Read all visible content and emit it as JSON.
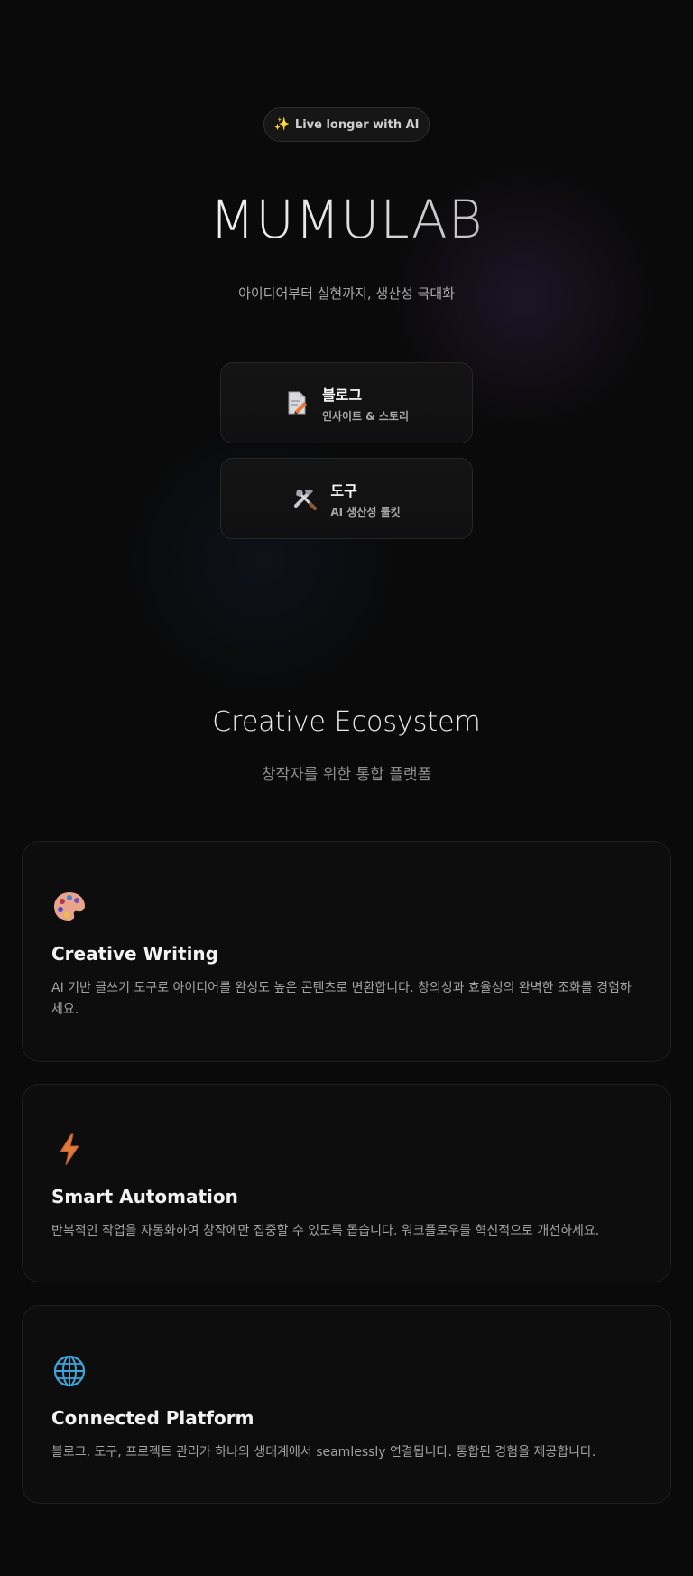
{
  "hero": {
    "pill_text": "Live longer with AI",
    "brand": "MUMULAB",
    "tagline": "아이디어부터 실현까지, 생산성 극대화"
  },
  "nav_cards": [
    {
      "title": "블로그",
      "subtitle": "인사이트 & 스토리",
      "icon": "memo-icon"
    },
    {
      "title": "도구",
      "subtitle": "AI 생산성 툴킷",
      "icon": "tools-icon"
    }
  ],
  "ecosystem": {
    "title": "Creative Ecosystem",
    "subtitle": "창작자를 위한 통합 플랫폼"
  },
  "features": [
    {
      "icon": "palette-icon",
      "title": "Creative Writing",
      "description": "AI 기반 글쓰기 도구로 아이디어를 완성도 높은 콘텐츠로 변환합니다. 창의성과 효율성의 완벽한 조화를 경험하세요."
    },
    {
      "icon": "lightning-icon",
      "title": "Smart Automation",
      "description": "반복적인 작업을 자동화하여 창작에만 집중할 수 있도록 돕습니다. 워크플로우를 혁신적으로 개선하세요."
    },
    {
      "icon": "globe-icon",
      "title": "Connected Platform",
      "description": "블로그, 도구, 프로젝트 관리가 하나의 생태계에서 seamlessly 연결됩니다. 통합된 경험을 제공합니다."
    }
  ],
  "colors": {
    "background": "#0a0a0a",
    "sparkle": "#e9b85a",
    "lightning": "#e07a3a",
    "globe": "#3aa6d9"
  }
}
